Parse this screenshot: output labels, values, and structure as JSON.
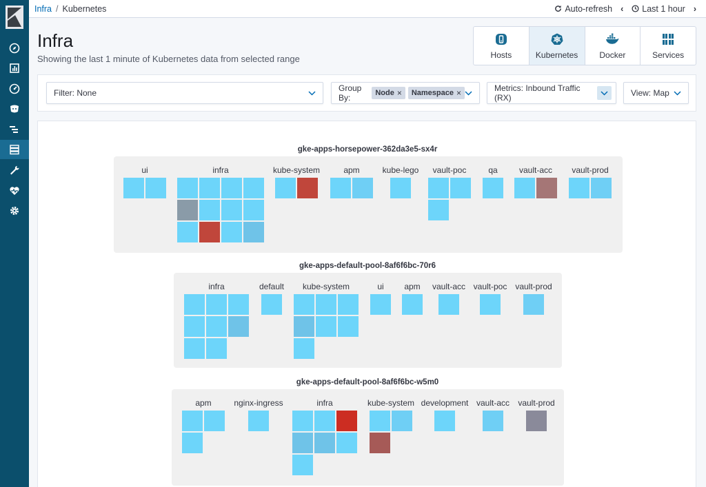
{
  "breadcrumb": {
    "parent": "Infra",
    "separator": "/",
    "current": "Kubernetes"
  },
  "toolbar": {
    "auto_refresh": "Auto-refresh",
    "time_range": "Last 1 hour"
  },
  "header": {
    "title": "Infra",
    "subtitle": "Showing the last 1 minute of Kubernetes data from selected range"
  },
  "tabs": [
    {
      "label": "Hosts",
      "icon": "hosts-icon"
    },
    {
      "label": "Kubernetes",
      "icon": "kubernetes-icon",
      "active": true
    },
    {
      "label": "Docker",
      "icon": "docker-icon"
    },
    {
      "label": "Services",
      "icon": "services-icon"
    }
  ],
  "filters": {
    "filter_label": "Filter: None",
    "group_by_label": "Group By:",
    "group_by_chips": [
      "Node",
      "Namespace"
    ],
    "metrics_label": "Metrics: Inbound Traffic (RX)",
    "view_label": "View: Map"
  },
  "colors": {
    "sidebar": "#0b4f6c",
    "healthy": "#6dd5fa",
    "link": "#006bb4",
    "critical": "#c9302c"
  },
  "nodes": [
    {
      "title": "gke-apps-horsepower-362da3e5-sx4r",
      "groups": [
        {
          "name": "ui",
          "cells": [
            "#6dd5fa",
            "#6dd5fa"
          ]
        },
        {
          "name": "infra",
          "cells": [
            "#6dd5fa",
            "#6dd5fa",
            "#6dd5fa",
            "#6dd5fa",
            "#8a9ba8",
            "#6dd5fa",
            "#6dd5fa",
            "#6dd5fa",
            "#6dd5fa",
            "#c0463b",
            "#6dd5fa",
            "#6fc3e8"
          ]
        },
        {
          "name": "kube-system",
          "cells": [
            "#6dd5fa",
            "#c0463b"
          ]
        },
        {
          "name": "apm",
          "cells": [
            "#6dd5fa",
            "#6fcff5"
          ]
        },
        {
          "name": "kube-lego",
          "cells": [
            "#6dd5fa"
          ]
        },
        {
          "name": "vault-poc",
          "cells": [
            "#6dd5fa",
            "#6dd5fa",
            "#6dd5fa"
          ]
        },
        {
          "name": "qa",
          "cells": [
            "#6dd5fa"
          ]
        },
        {
          "name": "vault-acc",
          "cells": [
            "#6dd5fa",
            "#a57676"
          ]
        },
        {
          "name": "vault-prod",
          "cells": [
            "#6dd5fa",
            "#6fcff5"
          ]
        }
      ]
    },
    {
      "title": "gke-apps-default-pool-8af6f6bc-70r6",
      "groups": [
        {
          "name": "infra",
          "cells": [
            "#6dd5fa",
            "#6dd5fa",
            "#6dd5fa",
            "#6dd5fa",
            "#6dd5fa",
            "#6fc3e8",
            "#6dd5fa",
            "#6dd5fa"
          ]
        },
        {
          "name": "default",
          "cells": [
            "#6dd5fa"
          ]
        },
        {
          "name": "kube-system",
          "cells": [
            "#6dd5fa",
            "#6dd5fa",
            "#6dd5fa",
            "#6fc3e8",
            "#6dd5fa",
            "#6dd5fa",
            "#6dd5fa"
          ]
        },
        {
          "name": "ui",
          "cells": [
            "#6dd5fa"
          ]
        },
        {
          "name": "apm",
          "cells": [
            "#6dd5fa"
          ]
        },
        {
          "name": "vault-acc",
          "cells": [
            "#6dd5fa"
          ]
        },
        {
          "name": "vault-poc",
          "cells": [
            "#6dd5fa"
          ]
        },
        {
          "name": "vault-prod",
          "cells": [
            "#6fcff5"
          ]
        }
      ]
    },
    {
      "title": "gke-apps-default-pool-8af6f6bc-w5m0",
      "groups": [
        {
          "name": "apm",
          "cells": [
            "#6dd5fa",
            "#6dd5fa",
            "#6dd5fa"
          ]
        },
        {
          "name": "nginx-ingress",
          "cells": [
            "#6dd5fa"
          ]
        },
        {
          "name": "infra",
          "cells": [
            "#6dd5fa",
            "#6dd5fa",
            "#cc2d22",
            "#6fc3e8",
            "#6fc3e8",
            "#6dd5fa",
            "#6dd5fa"
          ]
        },
        {
          "name": "kube-system",
          "cells": [
            "#6dd5fa",
            "#6fcff5",
            "#a65a57"
          ]
        },
        {
          "name": "development",
          "cells": [
            "#6dd5fa"
          ]
        },
        {
          "name": "vault-acc",
          "cells": [
            "#6fcff5"
          ]
        },
        {
          "name": "vault-prod",
          "cells": [
            "#8a8a9a"
          ]
        }
      ]
    }
  ]
}
